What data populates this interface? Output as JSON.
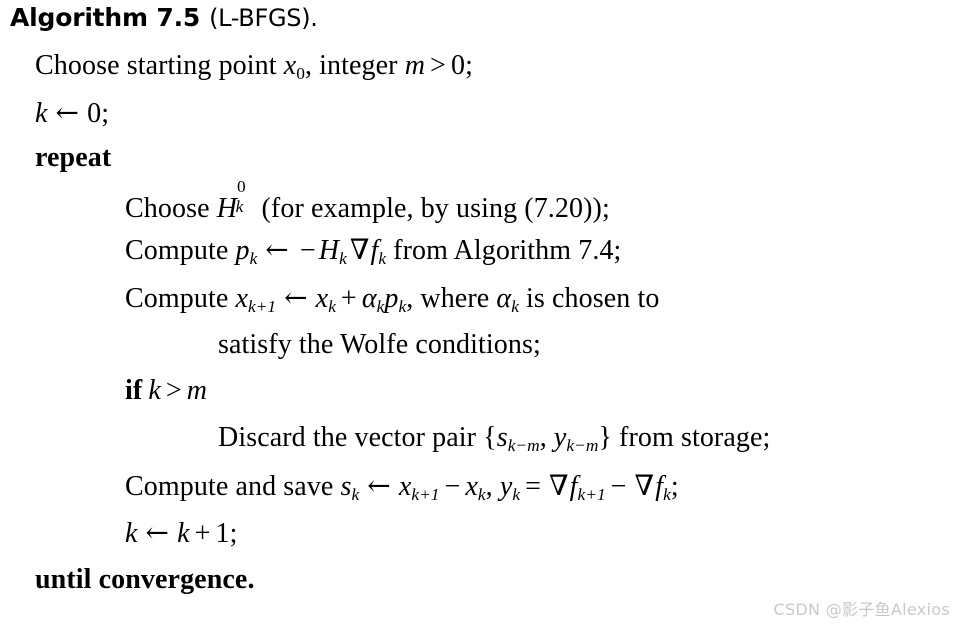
{
  "document": {
    "kind": "algorithm-pseudocode-figure",
    "background_color": "#ffffff",
    "text_color": "#000000"
  },
  "heading": {
    "label": "Algorithm 7.5",
    "parenthetical": "(L-BFGS)."
  },
  "lines": {
    "l1": {
      "indent": 0,
      "plain": "Choose starting point x0, integer m > 0;",
      "parts": {
        "text1": "Choose starting point ",
        "var_x": "x",
        "sub_x": "0",
        "text2": ", integer ",
        "var_m": "m",
        "op_gt": ">",
        "num_0": "0",
        "semi": ";"
      }
    },
    "l2": {
      "indent": 0,
      "plain": "k ← 0;",
      "parts": {
        "var_k": "k",
        "arrow": "←",
        "num_0": "0",
        "semi": ";"
      }
    },
    "l3": {
      "indent": 0,
      "plain": "repeat",
      "bold": true
    },
    "l4": {
      "indent": 1,
      "plain": "Choose H_k^0 (for example, by using (7.20));",
      "parts": {
        "text1": "Choose ",
        "var_H": "H",
        "sup_H": "0",
        "sub_H": "k",
        "text2": " (for example, by using (7.20));"
      }
    },
    "l5": {
      "indent": 1,
      "plain": "Compute p_k ← −H_k ∇f_k from Algorithm 7.4;",
      "parts": {
        "text1": "Compute ",
        "var_p": "p",
        "sub_p": "k",
        "arrow": "←",
        "minus": "−",
        "var_H": "H",
        "sub_H": "k",
        "nabla": "∇",
        "var_f": "f",
        "sub_f": "k",
        "text2": " from Algorithm 7.4;"
      }
    },
    "l6": {
      "indent": 1,
      "plain": "Compute x_{k+1} ← x_k + α_k p_k, where α_k is chosen to",
      "parts": {
        "text1": "Compute ",
        "var_x1": "x",
        "sub_x1": "k+1",
        "arrow": "←",
        "var_x2": "x",
        "sub_x2": "k",
        "plus": "+",
        "var_alpha": "α",
        "sub_alpha": "k",
        "var_p": "p",
        "sub_p": "k",
        "text2": ", where ",
        "var_alpha2": "α",
        "sub_alpha2": "k",
        "text3": " is chosen to"
      }
    },
    "l7": {
      "indent": 2,
      "plain": "satisfy the Wolfe conditions;"
    },
    "l8": {
      "indent": 1,
      "plain": "if k > m",
      "bold_keyword": "if",
      "parts": {
        "var_k": "k",
        "op_gt": ">",
        "var_m": "m"
      }
    },
    "l9": {
      "indent": 2,
      "plain": "Discard the vector pair {s_{k−m}, y_{k−m}} from storage;",
      "parts": {
        "text1": "Discard the vector pair {",
        "var_s": "s",
        "sub_s": "k−m",
        "comma": ", ",
        "var_y": "y",
        "sub_y": "k−m",
        "text2": "} from storage;"
      }
    },
    "l10": {
      "indent": 1,
      "plain": "Compute and save s_k ← x_{k+1} − x_k, y_k = ∇f_{k+1} − ∇f_k;",
      "parts": {
        "text1": "Compute and save ",
        "var_s": "s",
        "sub_s": "k",
        "arrow": "←",
        "var_x1": "x",
        "sub_x1": "k+1",
        "minus1": "−",
        "var_x2": "x",
        "sub_x2": "k",
        "comma": ", ",
        "var_y": "y",
        "sub_y": "k",
        "eq": "=",
        "nabla1": "∇",
        "var_f1": "f",
        "sub_f1": "k+1",
        "minus2": "−",
        "nabla2": "∇",
        "var_f2": "f",
        "sub_f2": "k",
        "semi": ";"
      }
    },
    "l11": {
      "indent": 1,
      "plain": "k ← k + 1;",
      "parts": {
        "var_k1": "k",
        "arrow": "←",
        "var_k2": "k",
        "plus": "+",
        "num_1": "1",
        "semi": ";"
      }
    },
    "l12": {
      "indent": 0,
      "plain": "until convergence.",
      "bold": true
    }
  },
  "watermark": {
    "text": "CSDN @影子鱼Alexios",
    "color": "#c9c9c9"
  }
}
